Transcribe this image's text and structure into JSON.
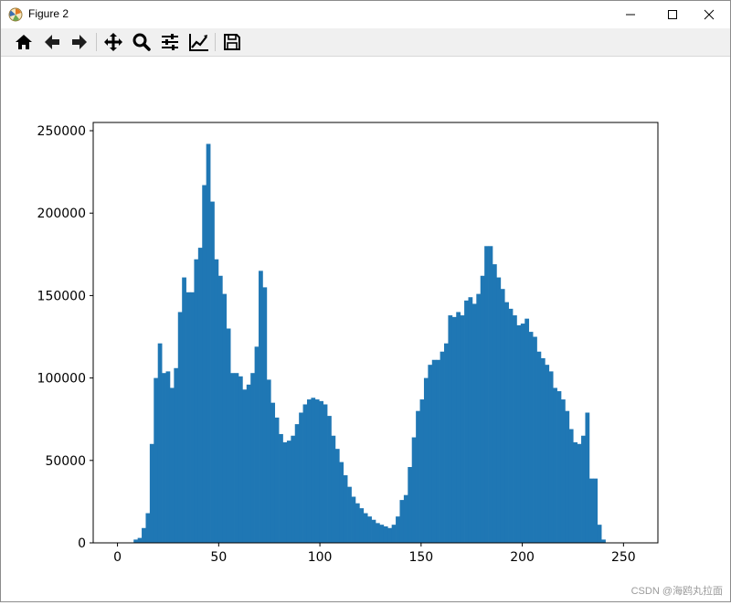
{
  "window": {
    "title": "Figure 2",
    "controls": [
      "minimize",
      "maximize",
      "close"
    ]
  },
  "toolbar": {
    "buttons": [
      {
        "name": "home",
        "icon": "home-icon"
      },
      {
        "name": "back",
        "icon": "arrow-left-icon"
      },
      {
        "name": "forward",
        "icon": "arrow-right-icon"
      },
      {
        "name": "pan",
        "icon": "move-icon"
      },
      {
        "name": "zoom",
        "icon": "zoom-icon"
      },
      {
        "name": "configure-subplots",
        "icon": "sliders-icon"
      },
      {
        "name": "edit-axis",
        "icon": "line-chart-icon"
      },
      {
        "name": "save",
        "icon": "save-icon"
      }
    ]
  },
  "colors": {
    "bar": "#1f77b4"
  },
  "chart_data": {
    "type": "bar",
    "title": "",
    "xlabel": "",
    "ylabel": "",
    "xlim": [
      -12,
      267
    ],
    "ylim": [
      0,
      255000
    ],
    "xticks": [
      0,
      50,
      100,
      150,
      200,
      250
    ],
    "yticks": [
      0,
      50000,
      100000,
      150000,
      200000,
      250000
    ],
    "bins": 128,
    "bin_width": 1.9921875,
    "values": [
      0,
      0,
      0,
      0,
      2000,
      3000,
      9000,
      18000,
      60000,
      100000,
      121000,
      103000,
      104000,
      94000,
      106000,
      140000,
      161000,
      152000,
      152000,
      172000,
      179000,
      217000,
      242000,
      207000,
      172000,
      162000,
      151000,
      130000,
      103000,
      103000,
      101000,
      93000,
      96000,
      103000,
      119000,
      165000,
      155000,
      99000,
      85000,
      76000,
      66000,
      61000,
      62000,
      65000,
      72000,
      79000,
      84000,
      87000,
      88000,
      87000,
      86000,
      84000,
      77000,
      65000,
      57000,
      49000,
      41000,
      34000,
      28000,
      24000,
      21000,
      18000,
      16000,
      14000,
      12000,
      11000,
      10000,
      9000,
      11000,
      16000,
      26000,
      29000,
      46000,
      64000,
      80000,
      87000,
      100000,
      108000,
      111000,
      111000,
      116000,
      121000,
      138000,
      137000,
      140000,
      138000,
      147000,
      149000,
      145000,
      151000,
      162000,
      180000,
      180000,
      169000,
      161000,
      154000,
      146000,
      142000,
      138000,
      132000,
      133000,
      136000,
      128000,
      125000,
      116000,
      112000,
      108000,
      104000,
      94000,
      92000,
      87000,
      80000,
      69000,
      61000,
      60000,
      65000,
      79000,
      39000,
      39000,
      11000,
      2000,
      0,
      0,
      0,
      0,
      0,
      0,
      0
    ],
    "grid": false,
    "legend": "none"
  },
  "watermark": "CSDN @海鸥丸拉面"
}
